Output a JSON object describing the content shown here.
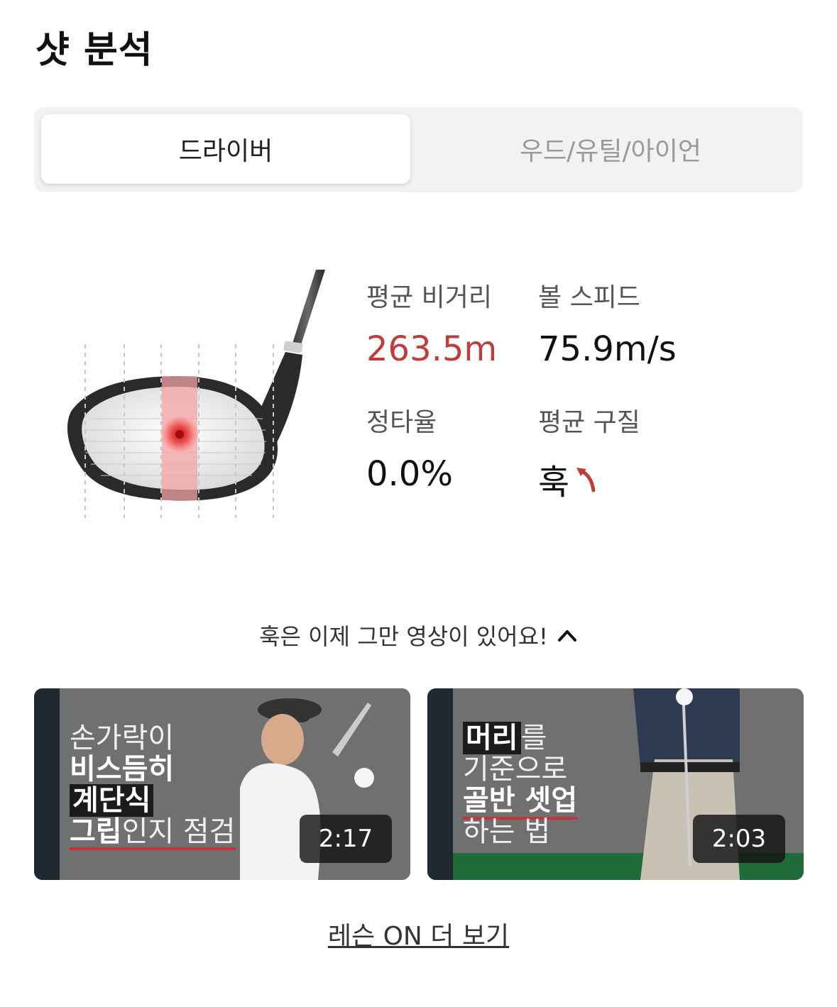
{
  "page": {
    "title": "샷 분석"
  },
  "tabs": [
    {
      "label": "드라이버",
      "active": true
    },
    {
      "label": "우드/유틸/아이언",
      "active": false
    }
  ],
  "stats": {
    "avg_distance": {
      "label": "평균 비거리",
      "value": "263.5m",
      "color": "#c23b3b"
    },
    "ball_speed": {
      "label": "볼 스피드",
      "value": "75.9m/s"
    },
    "sweet_spot_rate": {
      "label": "정타율",
      "value": "0.0%"
    },
    "avg_ball_flight": {
      "label": "평균 구질",
      "value": "훅",
      "icon": "hook-arrow-icon",
      "icon_color": "#c23b3b"
    }
  },
  "videos": {
    "prompt": "훅은 이제 그만 영상이 있어요!",
    "items": [
      {
        "line1": "손가락이",
        "line2": "비스듬히",
        "line3": "계단식",
        "line4a": "그립",
        "line4b": "인지 점검",
        "duration": "2:17"
      },
      {
        "line1a": "머리",
        "line1b": "를",
        "line2": "기준으로",
        "line3": "골반 셋업",
        "line4": "하는 법",
        "duration": "2:03"
      }
    ]
  },
  "more_link": "레슨 ON 더 보기"
}
